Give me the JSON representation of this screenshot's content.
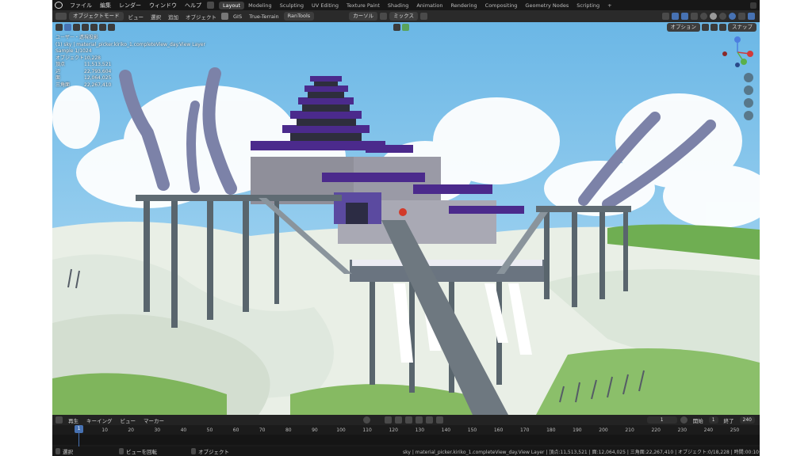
{
  "menu": {
    "items": [
      "ファイル",
      "編集",
      "レンダー",
      "ウィンドウ",
      "ヘルプ"
    ],
    "workspaces": [
      "Layout",
      "Modeling",
      "Sculpting",
      "UV Editing",
      "Texture Paint",
      "Shading",
      "Animation",
      "Rendering",
      "Compositing",
      "Geometry Nodes",
      "Scripting"
    ],
    "active_workspace": "Layout",
    "add_tab": "+"
  },
  "header": {
    "mode": "オブジェクトモード",
    "view": "ビュー",
    "select": "選択",
    "add": "追加",
    "object": "オブジェクト",
    "gis": "GIS",
    "true_terrain": "True-Terrain",
    "rantools": "RanTools",
    "pivot": "カーソル",
    "blend": "ミックス"
  },
  "viewport": {
    "options": "オプション",
    "snap": "スナップ",
    "overlay_lines": [
      {
        "k": "ユーザー・透視投影",
        "v": ""
      },
      {
        "k": "(1) sky | material_picker.kiriko_1.completeView_day.View Layer",
        "v": ""
      },
      {
        "k": "Sample 1/1024",
        "v": ""
      },
      {
        "k": "オブジェクト",
        "v": "10,228"
      },
      {
        "k": "頂点",
        "v": "11,513,521"
      },
      {
        "k": "辺",
        "v": "22,793,604"
      },
      {
        "k": "面",
        "v": "12,064,025"
      },
      {
        "k": "三角面",
        "v": "22,267,410"
      }
    ]
  },
  "timeline": {
    "playback": "再生",
    "keying": "キーイング",
    "view": "ビュー",
    "marker": "マーカー",
    "current_frame": "1",
    "start_label": "開始",
    "start": "1",
    "end_label": "終了",
    "end": "240",
    "frames": [
      "1",
      "10",
      "20",
      "30",
      "40",
      "50",
      "60",
      "70",
      "80",
      "90",
      "100",
      "110",
      "120",
      "130",
      "140",
      "150",
      "160",
      "170",
      "180",
      "190",
      "200",
      "210",
      "220",
      "230",
      "240",
      "250"
    ]
  },
  "status": {
    "select": "選択",
    "rotate": "ビューを回転",
    "object": "オブジェクト",
    "stats": "sky | material_picker.kiriko_1.completeView_day.View Layer | 頂点:11,513,521 | 面:12,064,025 | 三角面:22,267,410 | オブジェクト:0/18,228 | 時間:00:10+00 (?)"
  },
  "colors": {
    "accent": "#4772b3",
    "sky": "#7fc4ec",
    "purple_roof": "#4b2a8c"
  }
}
